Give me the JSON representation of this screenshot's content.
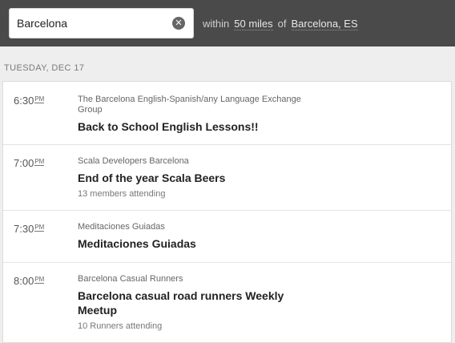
{
  "search": {
    "value": "Barcelona",
    "clear_icon": "clear-icon"
  },
  "filter": {
    "within": "within",
    "distance": "50 miles",
    "of": "of",
    "location": "Barcelona, ES"
  },
  "date_header": "TUESDAY, DEC 17",
  "events": [
    {
      "time": "6:30",
      "ampm": "PM",
      "group": "The Barcelona English-Spanish/any Language Exchange Group",
      "title": "Back to School English Lessons!!",
      "attendance": ""
    },
    {
      "time": "7:00",
      "ampm": "PM",
      "group": "Scala Developers Barcelona",
      "title": "End of the year Scala Beers",
      "attendance": "13 members attending"
    },
    {
      "time": "7:30",
      "ampm": "PM",
      "group": "Meditaciones Guiadas",
      "title": "Meditaciones Guiadas",
      "attendance": ""
    },
    {
      "time": "8:00",
      "ampm": "PM",
      "group": "Barcelona Casual Runners",
      "title": "Barcelona casual road runners Weekly Meetup",
      "attendance": "10 Runners attending"
    }
  ]
}
